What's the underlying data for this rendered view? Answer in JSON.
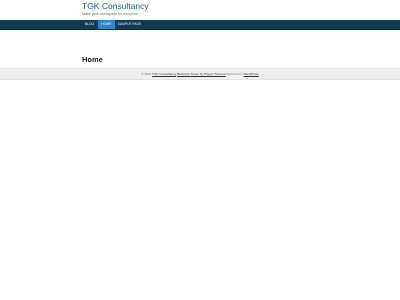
{
  "header": {
    "site_title": "TGK Consultancy",
    "tagline": "Make your workspace for everyone"
  },
  "nav": {
    "items": [
      {
        "label": "Blog"
      },
      {
        "label": "Home"
      },
      {
        "label": "Sample Page"
      }
    ],
    "active_index": 1
  },
  "main": {
    "page_title": "Home"
  },
  "footer": {
    "copyright": "© 2022",
    "site_link": "TGK Consultancy",
    "theme_link": "Business Times by Priyam Themes",
    "powered_by": "Powered by",
    "wp_link": "WordPress"
  },
  "colors": {
    "nav_bg": "#0f3b55",
    "nav_active": "#2a87c8",
    "title_color": "#1f5a8a"
  }
}
